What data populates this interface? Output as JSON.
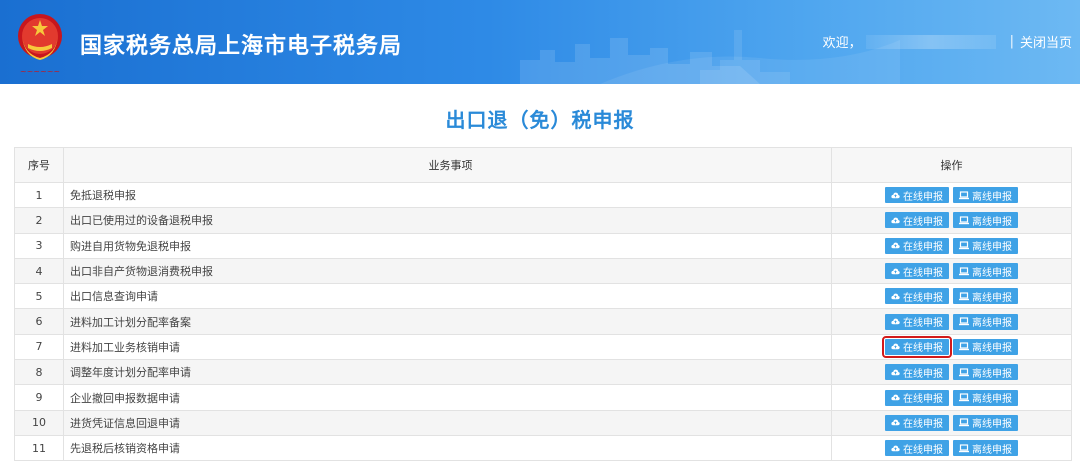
{
  "header": {
    "title": "国家税务总局上海市电子税务局",
    "welcome": "欢迎，",
    "separator": "|",
    "close_label": "关闭当页"
  },
  "page": {
    "title": "出口退（免）税申报"
  },
  "table": {
    "columns": [
      "序号",
      "业务事项",
      "操作"
    ],
    "online_label": "在线申报",
    "offline_label": "离线申报",
    "highlighted_row": 7,
    "rows": [
      {
        "no": "1",
        "item": "免抵退税申报"
      },
      {
        "no": "2",
        "item": "出口已使用过的设备退税申报"
      },
      {
        "no": "3",
        "item": "购进自用货物免退税申报"
      },
      {
        "no": "4",
        "item": "出口非自产货物退消费税申报"
      },
      {
        "no": "5",
        "item": "出口信息查询申请"
      },
      {
        "no": "6",
        "item": "进料加工计划分配率备案"
      },
      {
        "no": "7",
        "item": "进料加工业务核销申请"
      },
      {
        "no": "8",
        "item": "调整年度计划分配率申请"
      },
      {
        "no": "9",
        "item": "企业撤回申报数据申请"
      },
      {
        "no": "10",
        "item": "进货凭证信息回退申请"
      },
      {
        "no": "11",
        "item": "先退税后核销资格申请"
      }
    ]
  },
  "colors": {
    "header_start": "#1a6fd1",
    "header_end": "#6db9f3",
    "title": "#2a8ad8",
    "button": "#3fa2e6",
    "highlight": "#d21a1a"
  },
  "icons": {
    "online": "cloud-upload-icon",
    "offline": "laptop-icon",
    "logo": "tax-emblem-icon"
  }
}
